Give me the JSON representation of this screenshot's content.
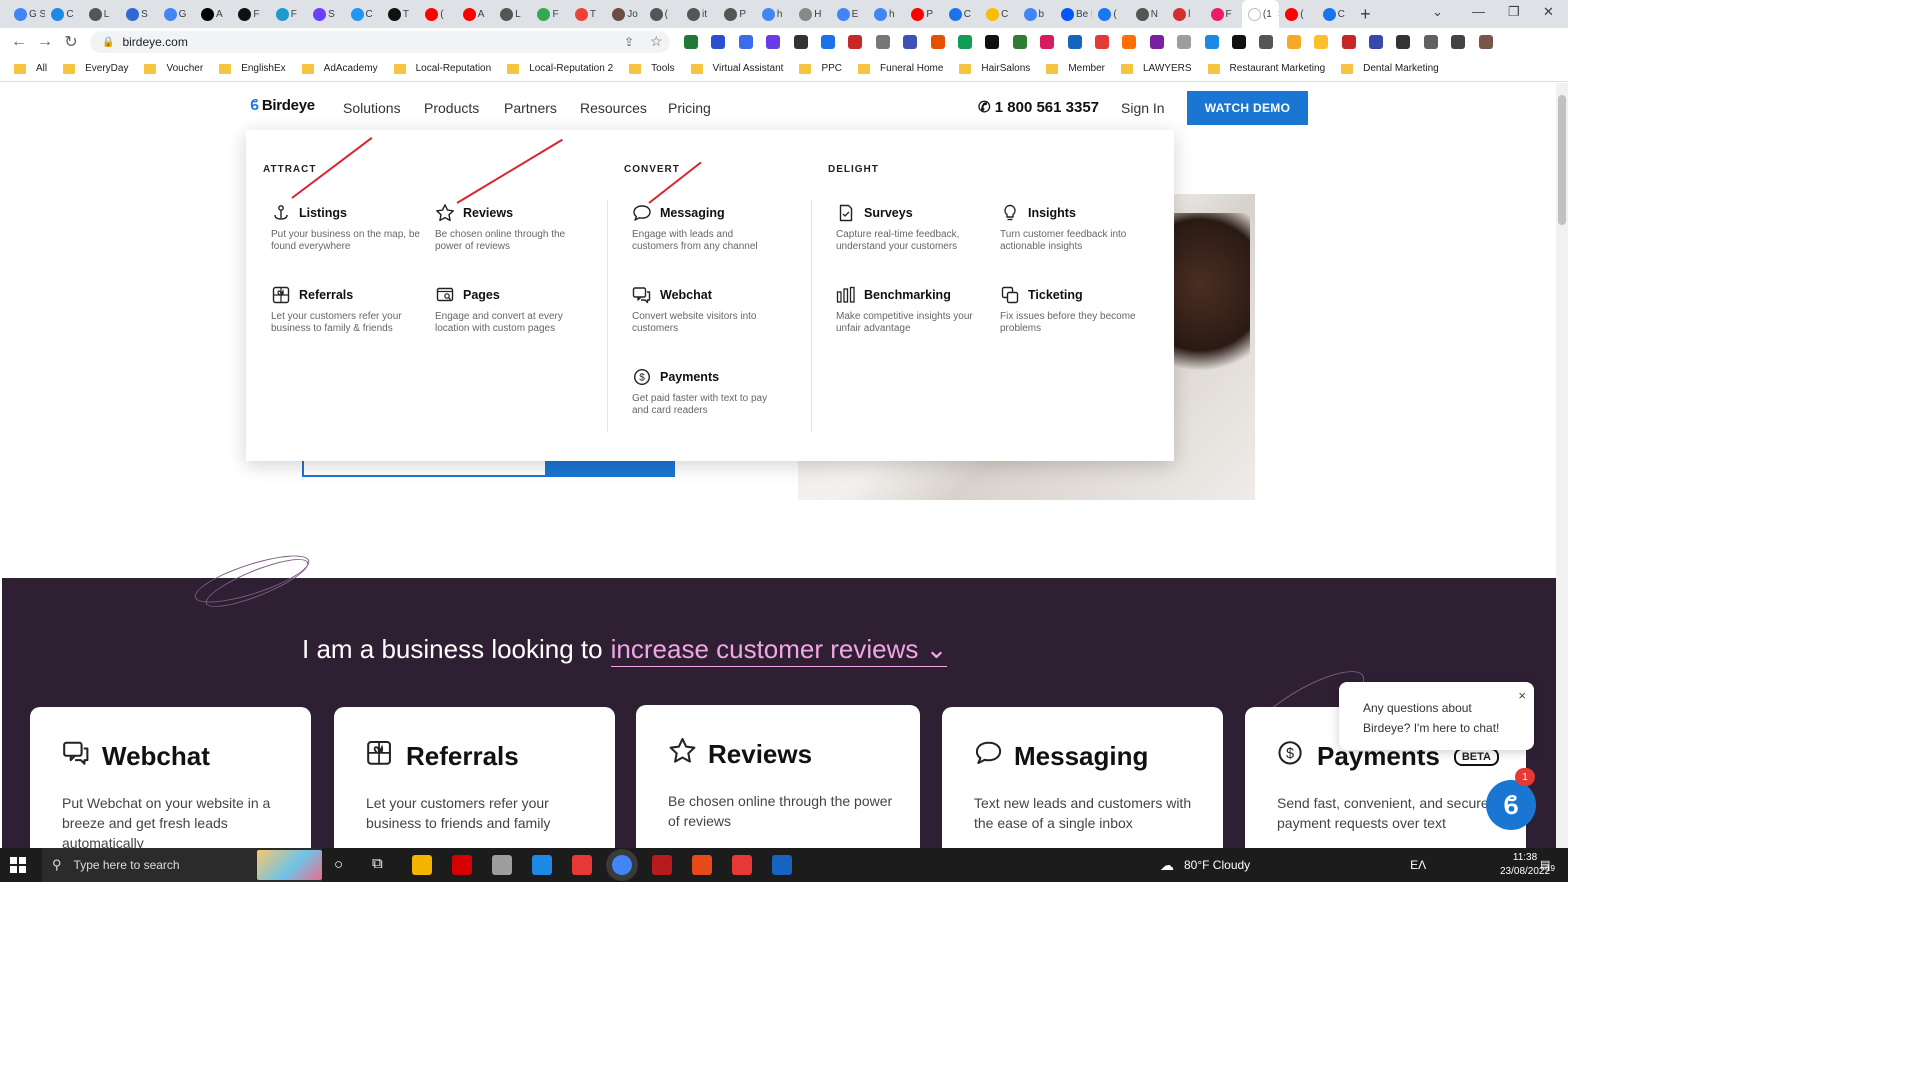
{
  "browser": {
    "tabs": [
      {
        "label": "G S",
        "color": "#4285f4"
      },
      {
        "label": "C",
        "color": "#1e88e5"
      },
      {
        "label": "L",
        "color": "#555555"
      },
      {
        "label": "S",
        "color": "#3367d6"
      },
      {
        "label": "G",
        "color": "#4285f4"
      },
      {
        "label": "A",
        "color": "#000000"
      },
      {
        "label": "F",
        "color": "#111111"
      },
      {
        "label": "F",
        "color": "#1b9bd1"
      },
      {
        "label": "S",
        "color": "#6a40ff"
      },
      {
        "label": "C",
        "color": "#2196f3"
      },
      {
        "label": "T",
        "color": "#111111"
      },
      {
        "label": "(",
        "color": "#ff0000"
      },
      {
        "label": "A",
        "color": "#ff0000"
      },
      {
        "label": "L",
        "color": "#555555"
      },
      {
        "label": "F",
        "color": "#34a853"
      },
      {
        "label": "T",
        "color": "#ea4335"
      },
      {
        "label": "Jo",
        "color": "#6d4c41"
      },
      {
        "label": "(",
        "color": "#555555"
      },
      {
        "label": "it",
        "color": "#555555"
      },
      {
        "label": "P",
        "color": "#555555"
      },
      {
        "label": "h",
        "color": "#4285f4"
      },
      {
        "label": "H",
        "color": "#888888"
      },
      {
        "label": "E",
        "color": "#4285f4"
      },
      {
        "label": "h",
        "color": "#4285f4"
      },
      {
        "label": "P",
        "color": "#ff0000"
      },
      {
        "label": "C",
        "color": "#1a73e8"
      },
      {
        "label": "C",
        "color": "#fbbc04"
      },
      {
        "label": "b",
        "color": "#4285f4"
      },
      {
        "label": "Be N",
        "color": "#0057ff"
      },
      {
        "label": "(",
        "color": "#1877f2"
      },
      {
        "label": "N",
        "color": "#555555"
      },
      {
        "label": "l",
        "color": "#d32f2f"
      },
      {
        "label": "F",
        "color": "#e91e63"
      },
      {
        "label": "(1",
        "color": "#ffffff"
      },
      {
        "label": "(",
        "color": "#ff0000"
      },
      {
        "label": "C",
        "color": "#1a73e8"
      }
    ],
    "active_tab_close": "×",
    "new_tab": "+",
    "window_controls": [
      "⌄",
      "—",
      "❐",
      "✕"
    ],
    "url": "birdeye.com",
    "bookmarks": [
      "All",
      "EveryDay",
      "Voucher",
      "EnglishEx",
      "AdAcademy",
      "Local-Reputation",
      "Local-Reputation 2",
      "Tools",
      "Virtual Assistant",
      "PPC",
      "Funeral Home",
      "HairSalons",
      "Member",
      "LAWYERS",
      "Restaurant Marketing",
      "Dental Marketing"
    ]
  },
  "site": {
    "logo": "Birdeye",
    "nav": [
      "Solutions",
      "Products",
      "Partners",
      "Resources",
      "Pricing"
    ],
    "phone": "1 800 561 3357",
    "sign_in": "Sign In",
    "watch_demo": "WATCH DEMO"
  },
  "mega_menu": {
    "sections": [
      {
        "title": "ATTRACT",
        "items": [
          {
            "name": "Listings",
            "desc": "Put your business on the map, be found everywhere",
            "icon": "anchor-pin-icon"
          },
          {
            "name": "Reviews",
            "desc": "Be chosen online through the power of reviews",
            "icon": "star-icon"
          },
          {
            "name": "Referrals",
            "desc": "Let your customers refer your business to family & friends",
            "icon": "gift-icon"
          },
          {
            "name": "Pages",
            "desc": "Engage and convert at every location with custom pages",
            "icon": "search-page-icon"
          }
        ]
      },
      {
        "title": "CONVERT",
        "items": [
          {
            "name": "Messaging",
            "desc": "Engage with leads and customers from any channel",
            "icon": "chat-bubble-icon"
          },
          {
            "name": "Webchat",
            "desc": "Convert website visitors into customers",
            "icon": "webchat-icon"
          },
          {
            "name": "Payments",
            "desc": "Get paid faster with text to pay and card readers",
            "icon": "dollar-circle-icon"
          }
        ]
      },
      {
        "title": "DELIGHT",
        "items": [
          {
            "name": "Surveys",
            "desc": "Capture real-time feedback, understand your customers",
            "icon": "survey-doc-icon"
          },
          {
            "name": "Insights",
            "desc": "Turn customer feedback into actionable insights",
            "icon": "lightbulb-icon"
          },
          {
            "name": "Benchmarking",
            "desc": "Make competitive insights your unfair advantage",
            "icon": "bars-icon"
          },
          {
            "name": "Ticketing",
            "desc": "Fix issues before they become problems",
            "icon": "ticket-icon"
          }
        ]
      }
    ]
  },
  "section": {
    "headline_prefix": "I am a business looking to",
    "headline_choice": "increase customer reviews",
    "cards": [
      {
        "title": "Webchat",
        "body": "Put Webchat on your website in a breeze and get fresh leads automatically",
        "icon": "webchat-icon"
      },
      {
        "title": "Referrals",
        "body": "Let your customers refer your business to friends and family",
        "icon": "gift-icon"
      },
      {
        "title": "Reviews",
        "body": "Be chosen online through the power of reviews",
        "icon": "star-icon"
      },
      {
        "title": "Messaging",
        "body": "Text new leads and customers with the ease of a single inbox",
        "icon": "chat-bubble-icon"
      },
      {
        "title": "Payments",
        "badge": "BETA",
        "body": "Send fast, convenient, and secure payment requests over text",
        "icon": "dollar-circle-icon"
      }
    ]
  },
  "chat": {
    "message": "Any questions about Birdeye? I'm here to chat!",
    "close": "×",
    "badge": "1"
  },
  "taskbar": {
    "search_placeholder": "Type here to search",
    "weather": "80°F  Cloudy",
    "lang": "ΕΛ",
    "time": "11:38",
    "date": "23/08/2022",
    "notif": "19"
  },
  "colors": {
    "brand_blue": "#1976d2",
    "purple_bg": "#2f1f33",
    "accent_pink": "#f1a6e4",
    "annotation_red": "#d9232d"
  }
}
